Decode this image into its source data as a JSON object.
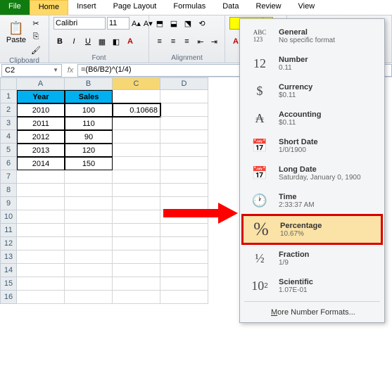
{
  "tabs": {
    "file": "File",
    "home": "Home",
    "insert": "Insert",
    "pagelayout": "Page Layout",
    "formulas": "Formulas",
    "data": "Data",
    "review": "Review",
    "view": "View"
  },
  "ribbon": {
    "clipboard_label": "Clipboard",
    "paste": "Paste",
    "font_label": "Font",
    "font_name": "Calibri",
    "font_size": "11",
    "align_label": "Alignment",
    "insert": "Insert"
  },
  "fx": {
    "namebox": "C2",
    "formula": "=(B6/B2)^(1/4)"
  },
  "grid": {
    "cols": [
      "A",
      "B",
      "C",
      "D"
    ],
    "rows": [
      "1",
      "2",
      "3",
      "4",
      "5",
      "6",
      "7",
      "8",
      "9",
      "10",
      "11",
      "12",
      "13",
      "14",
      "15",
      "16"
    ],
    "header": {
      "a": "Year",
      "b": "Sales"
    },
    "data": [
      {
        "y": "2010",
        "s": "100"
      },
      {
        "y": "2011",
        "s": "110"
      },
      {
        "y": "2012",
        "s": "90"
      },
      {
        "y": "2013",
        "s": "120"
      },
      {
        "y": "2014",
        "s": "150"
      }
    ],
    "c2": "0.10668"
  },
  "dropdown": {
    "items": [
      {
        "icon": "ABC\n123",
        "title": "General",
        "sub": "No specific format"
      },
      {
        "icon": "12",
        "title": "Number",
        "sub": "0.11"
      },
      {
        "icon": "$",
        "title": "Currency",
        "sub": "$0.11"
      },
      {
        "icon": "₳",
        "title": "Accounting",
        "sub": "$0.11"
      },
      {
        "icon": "📅",
        "title": "Short Date",
        "sub": "1/0/1900"
      },
      {
        "icon": "📅",
        "title": "Long Date",
        "sub": "Saturday, January 0, 1900"
      },
      {
        "icon": "🕐",
        "title": "Time",
        "sub": "2:33:37 AM"
      },
      {
        "icon": "%",
        "title": "Percentage",
        "sub": "10.67%"
      },
      {
        "icon": "½",
        "title": "Fraction",
        "sub": "1/9"
      },
      {
        "icon": "10²",
        "title": "Scientific",
        "sub": "1.07E-01"
      }
    ],
    "more": "More Number Formats..."
  },
  "chart_data": {
    "type": "table",
    "columns": [
      "Year",
      "Sales"
    ],
    "rows": [
      [
        "2010",
        100
      ],
      [
        "2011",
        110
      ],
      [
        "2012",
        90
      ],
      [
        "2013",
        120
      ],
      [
        "2014",
        150
      ]
    ]
  }
}
